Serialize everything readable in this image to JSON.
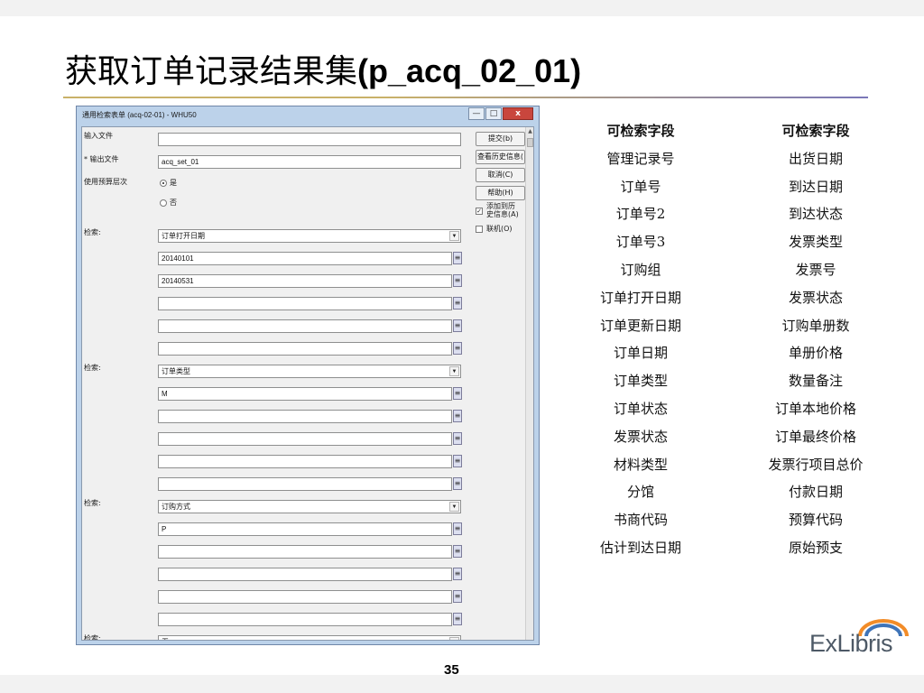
{
  "slide": {
    "title_cn": "获取订单记录结果集",
    "title_code": "(p_acq_02_01)",
    "page_number": "35",
    "logo_text": "ExLibris"
  },
  "dialog": {
    "title": "通用检索表单 (acq-02-01) - WHU50",
    "window_buttons": {
      "minimize": "—",
      "maximize": "□",
      "close": "x"
    },
    "labels": {
      "input_file": "输入文件",
      "output_file": "* 输出文件",
      "use_budget_level": "使用预算层次",
      "search": "检索:"
    },
    "radio": {
      "yes": "是",
      "no": "否",
      "selected": "yes"
    },
    "output_file_value": "acq_set_01",
    "groups": [
      {
        "select": "订单打开日期",
        "values": [
          "20140101",
          "20140531",
          "",
          "",
          ""
        ]
      },
      {
        "select": "订单类型",
        "values": [
          "M",
          "",
          "",
          "",
          ""
        ]
      },
      {
        "select": "订购方式",
        "values": [
          "P",
          "",
          "",
          "",
          ""
        ]
      },
      {
        "select": "无"
      }
    ],
    "buttons": {
      "submit": "提交(b)",
      "history": "查看历史信息(",
      "cancel": "取消(C)",
      "help": "帮助(H)"
    },
    "checkboxes": {
      "add_history": "添加到历",
      "add_history_2": "史信息(A)",
      "online": "联机(O)"
    }
  },
  "fields_table": {
    "headers": [
      "可检索字段",
      "可检索字段"
    ],
    "left": [
      "管理记录号",
      "订单号",
      "订单号2",
      "订单号3",
      "订购组",
      "订单打开日期",
      "订单更新日期",
      "订单日期",
      "订单类型",
      "订单状态",
      "发票状态",
      "材料类型",
      "分馆",
      "书商代码",
      "估计到达日期"
    ],
    "right": [
      "出货日期",
      "到达日期",
      "到达状态",
      "发票类型",
      "发票号",
      "发票状态",
      "订购单册数",
      "单册价格",
      "数量备注",
      "订单本地价格",
      "订单最终价格",
      "发票行项目总价",
      "付款日期",
      "预算代码",
      "原始预支"
    ]
  },
  "colors": {
    "rule_gold": "#c9b169",
    "rule_purple": "#7a77b8",
    "window_frame": "#bcd2ea",
    "close_red": "#c9463d",
    "logo_orange": "#f28c28",
    "logo_blue": "#3f74b8"
  }
}
